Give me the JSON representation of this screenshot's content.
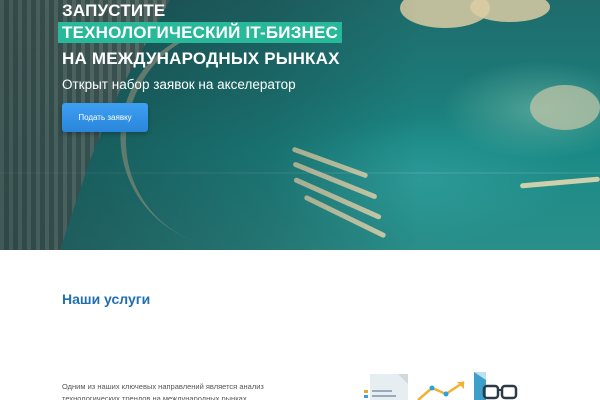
{
  "hero": {
    "title_line_1": "ЗАПУСТИТЕ",
    "title_line_2": "ТЕХНОЛОГИЧЕСКИЙ IT-БИЗНЕС",
    "title_line_3": "НА МЕЖДУНАРОДНЫХ РЫНКАХ",
    "subtitle": "Открыт набор заявок на акселератор",
    "cta_label": "Подать заявку"
  },
  "services": {
    "title": "Наши услуги",
    "description": "Одним из наших ключевых направлений является анализ технологических трендов на международных рынках"
  },
  "icons": {
    "illustration": [
      "document-icon",
      "growth-chart-icon",
      "glasses-icon"
    ]
  },
  "colors": {
    "accent_green": "#28b89a",
    "button_blue": "#2a86db",
    "heading_blue": "#1f6fb5"
  }
}
